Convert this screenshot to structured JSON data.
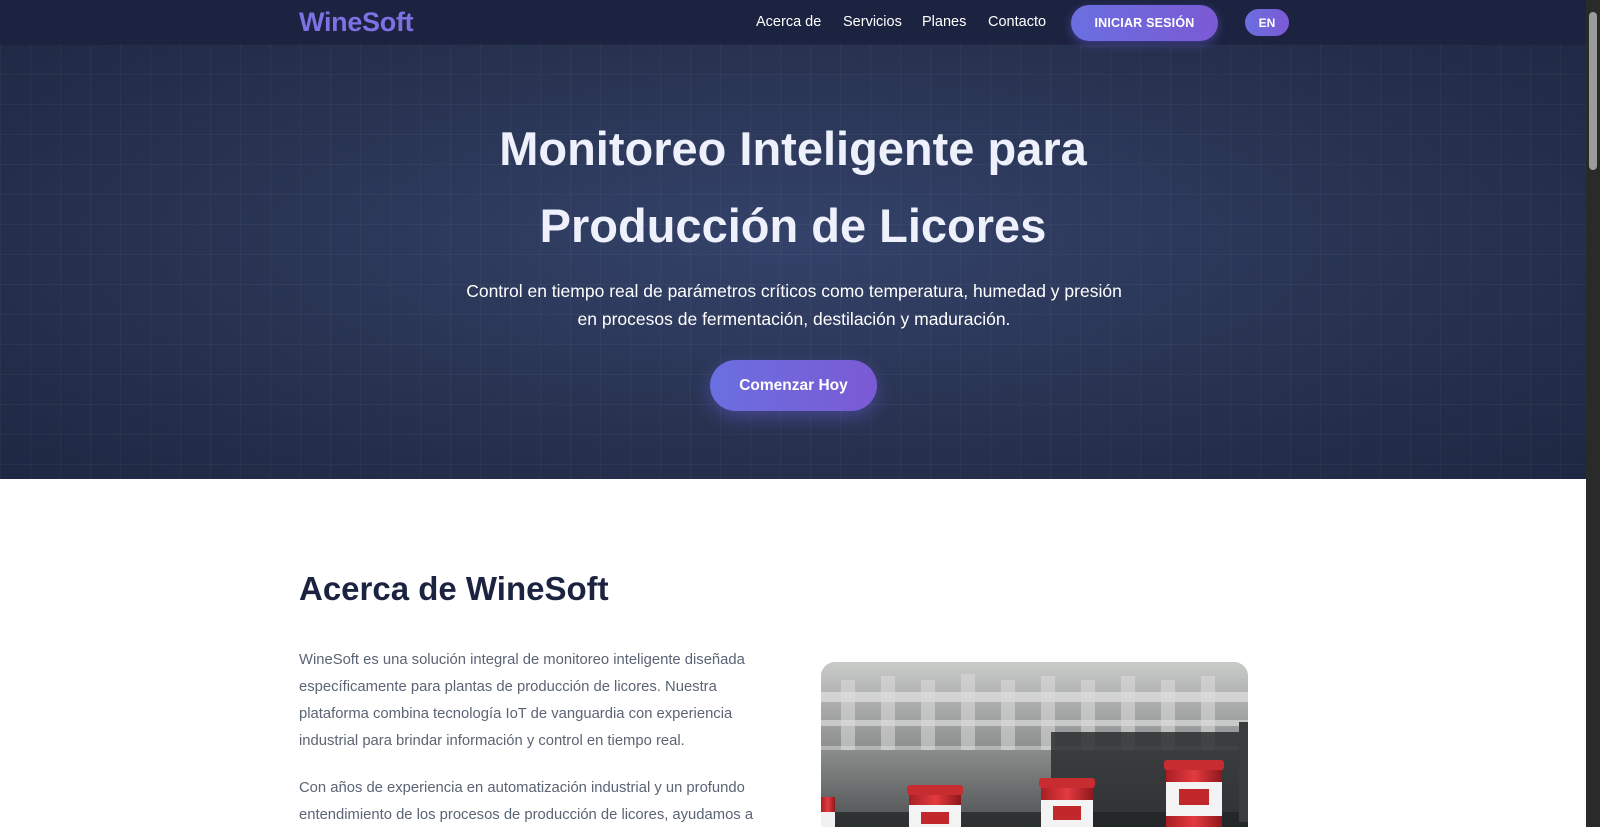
{
  "brand": {
    "name": "WineSoft"
  },
  "nav": {
    "links": [
      "Acerca de",
      "Servicios",
      "Planes",
      "Contacto"
    ],
    "login_label": "INICIAR SESIÓN",
    "lang_label": "EN"
  },
  "hero": {
    "title_line1": "Monitoreo Inteligente para",
    "title_line2": "Producción de Licores",
    "subtitle_line1": "Control en tiempo real de parámetros críticos como temperatura, humedad y presión",
    "subtitle_line2": "en procesos de fermentación, destilación y maduración.",
    "cta_label": "Comenzar Hoy"
  },
  "about": {
    "title": "Acerca de WineSoft",
    "paragraph1": "WineSoft es una solución integral de monitoreo inteligente diseñada específicamente para plantas de producción de licores. Nuestra plataforma combina tecnología IoT de vanguardia con experiencia industrial para brindar información y control en tiempo real.",
    "paragraph2": "Con años de experiencia en automatización industrial y un profundo entendimiento de los procesos de producción de licores, ayudamos a"
  },
  "colors": {
    "navbar_bg": "#1c2340",
    "accent": "#6a6fe0",
    "hero_bg": "#283351",
    "heading": "#1c2340",
    "body_text": "#5b6474"
  }
}
